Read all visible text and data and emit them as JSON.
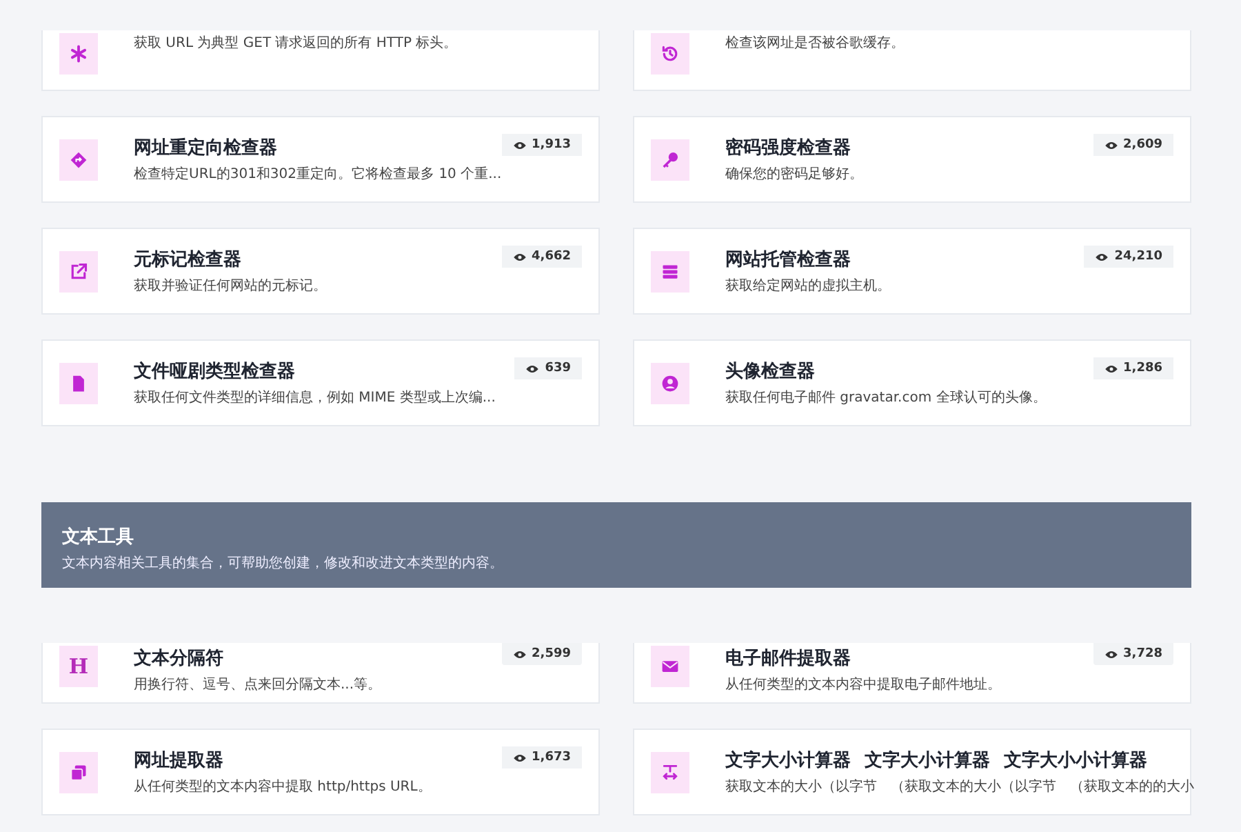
{
  "blocks": [
    {
      "kind": "cards",
      "clipped": true,
      "cards": [
        {
          "kind": "asterisk",
          "descriptions": [
            "获取 URL 为典型 GET 请求返回的所有 HTTP 标头。"
          ]
        },
        {
          "kind": "history",
          "descriptions": [
            "检查该网址是否被谷歌缓存。"
          ]
        }
      ]
    },
    {
      "kind": "cards",
      "clipped": false,
      "cards": [
        {
          "kind": "directions",
          "titles": [
            "网址重定向检查器"
          ],
          "descriptions": [
            "检查特定URL的301和302重定向。它将检查最多 10 个重..."
          ],
          "views": "1,913"
        },
        {
          "kind": "key",
          "titles": [
            "密码强度检查器"
          ],
          "descriptions": [
            "确保您的密码足够好。"
          ],
          "views": "2,609"
        }
      ]
    },
    {
      "kind": "cards",
      "clipped": false,
      "cards": [
        {
          "kind": "link",
          "titles": [
            "元标记检查器"
          ],
          "descriptions": [
            "获取并验证任何网站的元标记。"
          ],
          "views": "4,662"
        },
        {
          "kind": "server",
          "titles": [
            "网站托管检查器"
          ],
          "descriptions": [
            "获取给定网站的虚拟主机。"
          ],
          "views": "24,210"
        }
      ]
    },
    {
      "kind": "cards",
      "clipped": false,
      "cards": [
        {
          "kind": "file",
          "titles": [
            "文件哑剧类型检查器"
          ],
          "descriptions": [
            "获取任何文件类型的详细信息，例如 MIME 类型或上次编..."
          ],
          "views": "639"
        },
        {
          "kind": "user",
          "titles": [
            "头像检查器"
          ],
          "descriptions": [
            "获取任何电子邮件 gravatar.com 全球认可的头像。"
          ],
          "views": "1,286"
        }
      ]
    },
    {
      "kind": "banner",
      "title": "文本工具",
      "description": "文本内容相关工具的集合，可帮助您创建，修改和改进文本类型的内容。"
    },
    {
      "kind": "cards",
      "clipped": true,
      "cards": [
        {
          "kind": "glyph",
          "glyph": "H",
          "titles": [
            "文本分隔符"
          ],
          "descriptions": [
            "用换行符、逗号、点来回分隔文本...等。"
          ],
          "views": "2,599"
        },
        {
          "kind": "envelope",
          "titles": [
            "电子邮件提取器"
          ],
          "descriptions": [
            "从任何类型的文本内容中提取电子邮件地址。"
          ],
          "views": "3,728"
        }
      ]
    },
    {
      "kind": "cards",
      "clipped": false,
      "cards": [
        {
          "kind": "copy",
          "titles": [
            "网址提取器"
          ],
          "descriptions": [
            "从任何类型的文本内容中提取 http/https URL。"
          ],
          "views": "1,673"
        },
        {
          "kind": "textsize",
          "titles": [
            "文字大小计算器",
            "文字大小计算器",
            "文字大小小计算器"
          ],
          "descriptions": [
            "获取文本的大小（以字节",
            "（获取文本的大小（以字节",
            "（获取文本的的大小"
          ]
        }
      ]
    }
  ]
}
